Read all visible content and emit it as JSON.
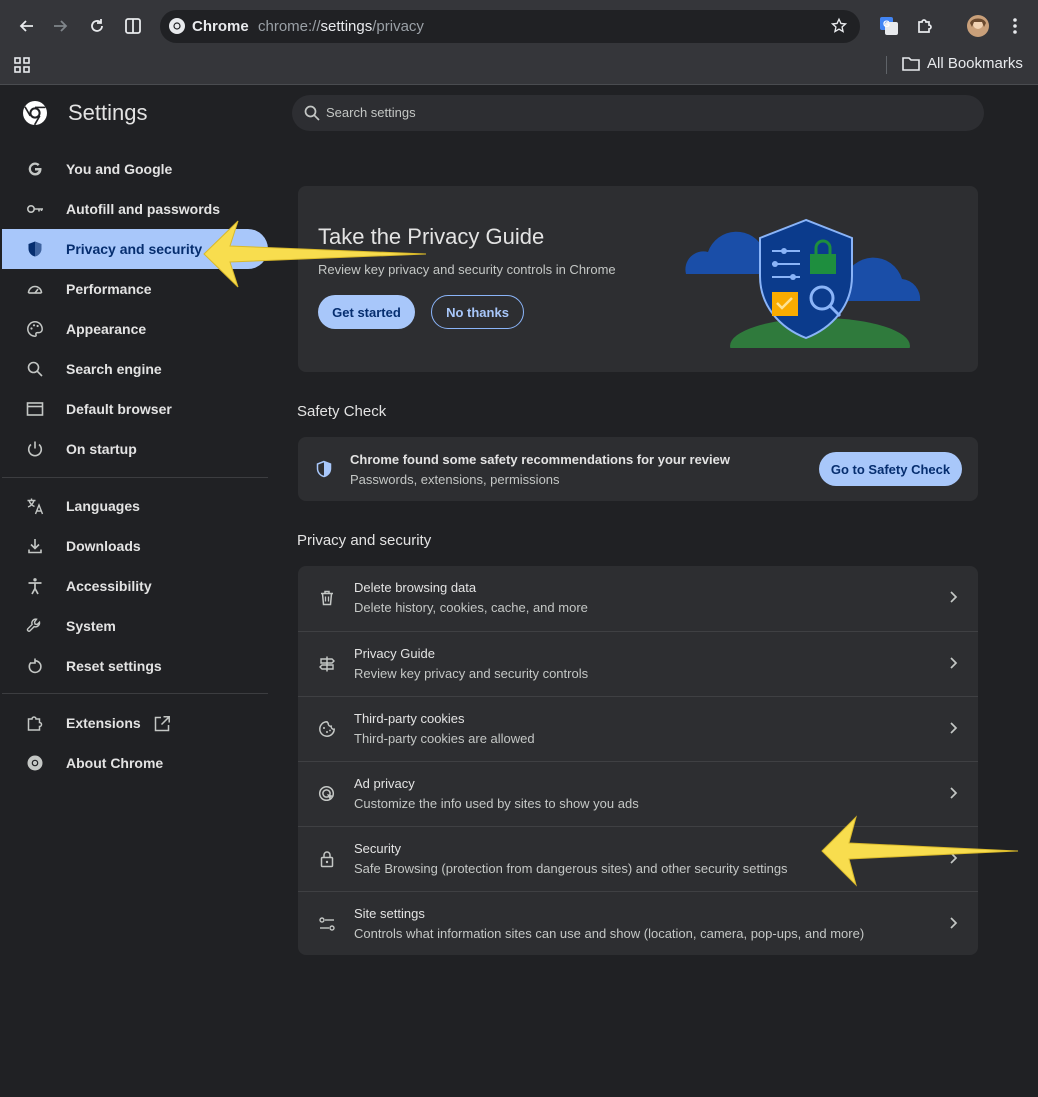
{
  "browser": {
    "tab_chip_label": "Chrome",
    "url_host": "chrome://",
    "url_path": "settings",
    "url_rest": "/privacy",
    "bookmarks_label": "All Bookmarks"
  },
  "settings": {
    "title": "Settings",
    "search_placeholder": "Search settings"
  },
  "sidebar": {
    "items": [
      {
        "label": "You and Google",
        "icon": "google-g-icon"
      },
      {
        "label": "Autofill and passwords",
        "icon": "key-icon"
      },
      {
        "label": "Privacy and security",
        "icon": "shield-icon",
        "active": true
      },
      {
        "label": "Performance",
        "icon": "speedometer-icon"
      },
      {
        "label": "Appearance",
        "icon": "palette-icon"
      },
      {
        "label": "Search engine",
        "icon": "search-icon"
      },
      {
        "label": "Default browser",
        "icon": "browser-window-icon"
      },
      {
        "label": "On startup",
        "icon": "power-icon"
      },
      {
        "label": "Languages",
        "icon": "translate-icon"
      },
      {
        "label": "Downloads",
        "icon": "download-icon"
      },
      {
        "label": "Accessibility",
        "icon": "accessibility-icon"
      },
      {
        "label": "System",
        "icon": "wrench-icon"
      },
      {
        "label": "Reset settings",
        "icon": "reset-icon"
      },
      {
        "label": "Extensions",
        "icon": "puzzle-icon"
      },
      {
        "label": "About Chrome",
        "icon": "chrome-logo-icon"
      }
    ]
  },
  "privacy_guide_card": {
    "title": "Take the Privacy Guide",
    "description": "Review key privacy and security controls in Chrome",
    "primary_button": "Get started",
    "secondary_button": "No thanks"
  },
  "safety_check": {
    "section_title": "Safety Check",
    "title": "Chrome found some safety recommendations for your review",
    "subtitle": "Passwords, extensions, permissions",
    "button": "Go to Safety Check"
  },
  "privacy_section": {
    "section_title": "Privacy and security",
    "rows": [
      {
        "title": "Delete browsing data",
        "subtitle": "Delete history, cookies, cache, and more",
        "icon": "trash-icon"
      },
      {
        "title": "Privacy Guide",
        "subtitle": "Review key privacy and security controls",
        "icon": "signpost-icon"
      },
      {
        "title": "Third-party cookies",
        "subtitle": "Third-party cookies are allowed",
        "icon": "cookie-icon"
      },
      {
        "title": "Ad privacy",
        "subtitle": "Customize the info used by sites to show you ads",
        "icon": "ad-target-icon"
      },
      {
        "title": "Security",
        "subtitle": "Safe Browsing (protection from dangerous sites) and other security settings",
        "icon": "lock-icon"
      },
      {
        "title": "Site settings",
        "subtitle": "Controls what information sites can use and show (location, camera, pop-ups, and more)",
        "icon": "tune-icon"
      }
    ]
  },
  "colors": {
    "accent": "#a8c7fa",
    "background": "#202124",
    "card": "#2d2e31",
    "annotation_arrow": "#f8dd4e"
  }
}
